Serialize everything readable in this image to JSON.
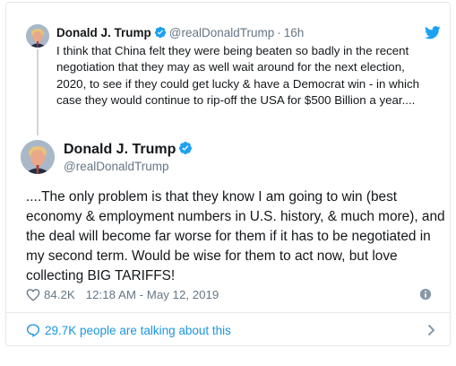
{
  "parent_tweet": {
    "name": "Donald J. Trump",
    "handle": "@realDonaldTrump",
    "separator": "·",
    "time": "16h",
    "text": "I think that China felt they were being beaten so badly in the recent negotiation that they may as well wait around for the next election, 2020, to see if they could get lucky & have a Democrat win - in which case they would continue to rip-off the USA for $500 Billion a year...."
  },
  "main_tweet": {
    "name": "Donald J. Trump",
    "handle": "@realDonaldTrump",
    "text": "....The only problem is that they know I am going to win (best economy & employment numbers in U.S. history, & much more), and the deal will become far worse for them if it has to be negotiated in my second term. Would be wise for them to act now, but love collecting BIG TARIFFS!",
    "likes": "84.2K",
    "timestamp": "12:18 AM - May 12, 2019"
  },
  "talking": {
    "label": "29.7K people are talking about this"
  },
  "colors": {
    "accent": "#1da1f2",
    "link": "#1b95e0",
    "muted": "#657786",
    "border": "#e1e8ed"
  },
  "icons": {
    "verified": "verified-badge-icon",
    "bird": "twitter-bird-icon",
    "heart": "heart-icon",
    "info": "info-icon",
    "bubble": "speech-bubble-icon",
    "chevron": "chevron-right-icon"
  }
}
